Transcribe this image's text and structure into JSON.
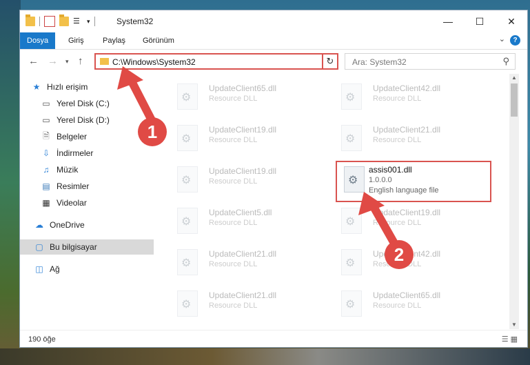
{
  "window": {
    "title": "System32",
    "controls": [
      "minimize",
      "maximize",
      "close"
    ]
  },
  "ribbon": {
    "tabs": [
      "Dosya",
      "Giriş",
      "Paylaş",
      "Görünüm"
    ],
    "help": "?"
  },
  "address": {
    "path": "C:\\Windows\\System32",
    "search_placeholder": "Ara: System32"
  },
  "sidebar": {
    "items": [
      {
        "label": "Hızlı erişim",
        "icon": "star-icon"
      },
      {
        "label": "Yerel Disk (C:)",
        "icon": "drive-icon"
      },
      {
        "label": "Yerel Disk (D:)",
        "icon": "drive-icon"
      },
      {
        "label": "Belgeler",
        "icon": "documents-icon"
      },
      {
        "label": "İndirmeler",
        "icon": "download-icon"
      },
      {
        "label": "Müzik",
        "icon": "music-icon"
      },
      {
        "label": "Resimler",
        "icon": "pictures-icon"
      },
      {
        "label": "Videolar",
        "icon": "video-icon"
      },
      {
        "label": "OneDrive",
        "icon": "cloud-icon"
      },
      {
        "label": "Bu bilgisayar",
        "icon": "computer-icon"
      },
      {
        "label": "Ağ",
        "icon": "network-icon"
      }
    ]
  },
  "files": [
    {
      "name": "UpdateClient65.dll",
      "desc": "Resource DLL"
    },
    {
      "name": "UpdateClient42.dll",
      "desc": "Resource DLL"
    },
    {
      "name": "UpdateClient19.dll",
      "desc": "Resource DLL"
    },
    {
      "name": "UpdateClient21.dll",
      "desc": "Resource DLL"
    },
    {
      "name": "UpdateClient19.dll",
      "desc": "Resource DLL"
    },
    {
      "name": "assis001.dll",
      "version": "1.0.0.0",
      "desc": "English language file"
    },
    {
      "name": "UpdateClient5.dll",
      "desc": "Resource DLL"
    },
    {
      "name": "UpdateClient19.dll",
      "desc": "Resource DLL"
    },
    {
      "name": "UpdateClient21.dll",
      "desc": "Resource DLL"
    },
    {
      "name": "UpdateClient42.dll",
      "desc": "Resource DLL"
    },
    {
      "name": "UpdateClient21.dll",
      "desc": "Resource DLL"
    },
    {
      "name": "UpdateClient65.dll",
      "desc": "Resource DLL"
    }
  ],
  "status": {
    "count": "190 öğe"
  },
  "annotations": {
    "step1": "1",
    "step2": "2",
    "color": "#e04a45"
  }
}
